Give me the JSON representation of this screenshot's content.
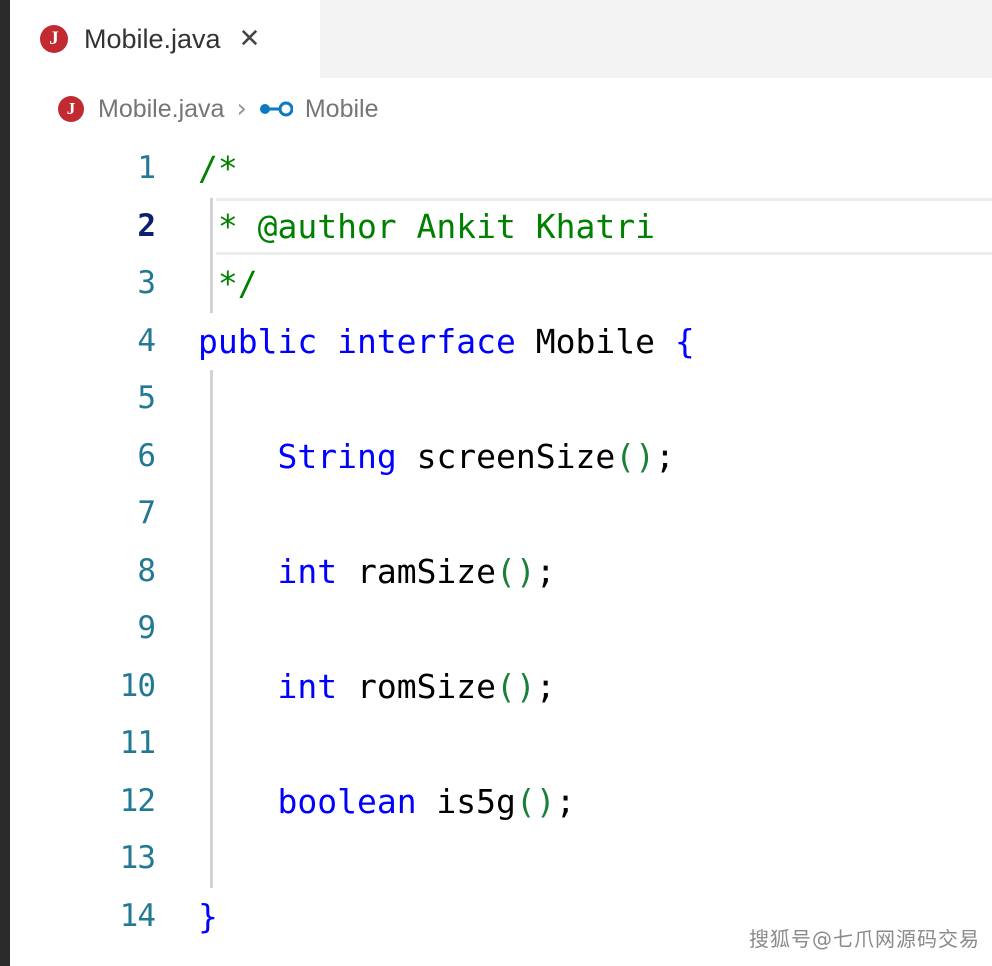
{
  "window": {
    "app": "Visual Studio Code",
    "theme": "light"
  },
  "tab_bar": {
    "tabs": [
      {
        "label": "Mobile.java",
        "icon": "java-file-icon",
        "icon_letter": "J",
        "active": true,
        "close_glyph": "✕"
      }
    ]
  },
  "breadcrumb": {
    "file_icon_letter": "J",
    "file_label": "Mobile.java",
    "separator": "›",
    "symbol_icon": "interface-symbol-icon",
    "symbol_label": "Mobile"
  },
  "editor": {
    "language": "java",
    "active_line": 2,
    "colors": {
      "keyword": "#0000ff",
      "comment": "#008000",
      "bracket": "#1a7f37",
      "plain": "#000000",
      "line_number": "#237893",
      "line_number_active": "#0b216f",
      "activity_bar": "#2b2b2b",
      "tab_bar_bg": "#f3f3f3",
      "active_tab_bg": "#ffffff",
      "indent_guide": "#d3d3d3",
      "current_line_border": "#ededed",
      "breadcrumb_text": "#767676"
    },
    "lines": [
      {
        "n": "1",
        "indent_guide": false,
        "tokens": [
          {
            "t": "/*",
            "c": "cmt"
          }
        ]
      },
      {
        "n": "2",
        "indent_guide": true,
        "tokens": [
          {
            "t": " * @author Ankit Khatri",
            "c": "cmt"
          }
        ]
      },
      {
        "n": "3",
        "indent_guide": true,
        "tokens": [
          {
            "t": " */",
            "c": "cmt"
          }
        ]
      },
      {
        "n": "4",
        "indent_guide": false,
        "tokens": [
          {
            "t": "public interface ",
            "c": "kw"
          },
          {
            "t": "Mobile ",
            "c": "plain"
          },
          {
            "t": "{",
            "c": "kw"
          }
        ]
      },
      {
        "n": "5",
        "indent_guide": true,
        "tokens": []
      },
      {
        "n": "6",
        "indent_guide": true,
        "tokens": [
          {
            "t": "    ",
            "c": "plain"
          },
          {
            "t": "String",
            "c": "kw"
          },
          {
            "t": " screenSize",
            "c": "plain"
          },
          {
            "t": "()",
            "c": "par"
          },
          {
            "t": ";",
            "c": "plain"
          }
        ]
      },
      {
        "n": "7",
        "indent_guide": true,
        "tokens": []
      },
      {
        "n": "8",
        "indent_guide": true,
        "tokens": [
          {
            "t": "    ",
            "c": "plain"
          },
          {
            "t": "int",
            "c": "kw"
          },
          {
            "t": " ramSize",
            "c": "plain"
          },
          {
            "t": "()",
            "c": "par"
          },
          {
            "t": ";",
            "c": "plain"
          }
        ]
      },
      {
        "n": "9",
        "indent_guide": true,
        "tokens": []
      },
      {
        "n": "10",
        "indent_guide": true,
        "tokens": [
          {
            "t": "    ",
            "c": "plain"
          },
          {
            "t": "int",
            "c": "kw"
          },
          {
            "t": " romSize",
            "c": "plain"
          },
          {
            "t": "()",
            "c": "par"
          },
          {
            "t": ";",
            "c": "plain"
          }
        ]
      },
      {
        "n": "11",
        "indent_guide": true,
        "tokens": []
      },
      {
        "n": "12",
        "indent_guide": true,
        "tokens": [
          {
            "t": "    ",
            "c": "plain"
          },
          {
            "t": "boolean",
            "c": "kw"
          },
          {
            "t": " is5g",
            "c": "plain"
          },
          {
            "t": "()",
            "c": "par"
          },
          {
            "t": ";",
            "c": "plain"
          }
        ]
      },
      {
        "n": "13",
        "indent_guide": true,
        "tokens": []
      },
      {
        "n": "14",
        "indent_guide": false,
        "tokens": [
          {
            "t": "}",
            "c": "kw"
          }
        ]
      }
    ]
  },
  "watermark": {
    "text": "搜狐号@七爪网源码交易"
  }
}
